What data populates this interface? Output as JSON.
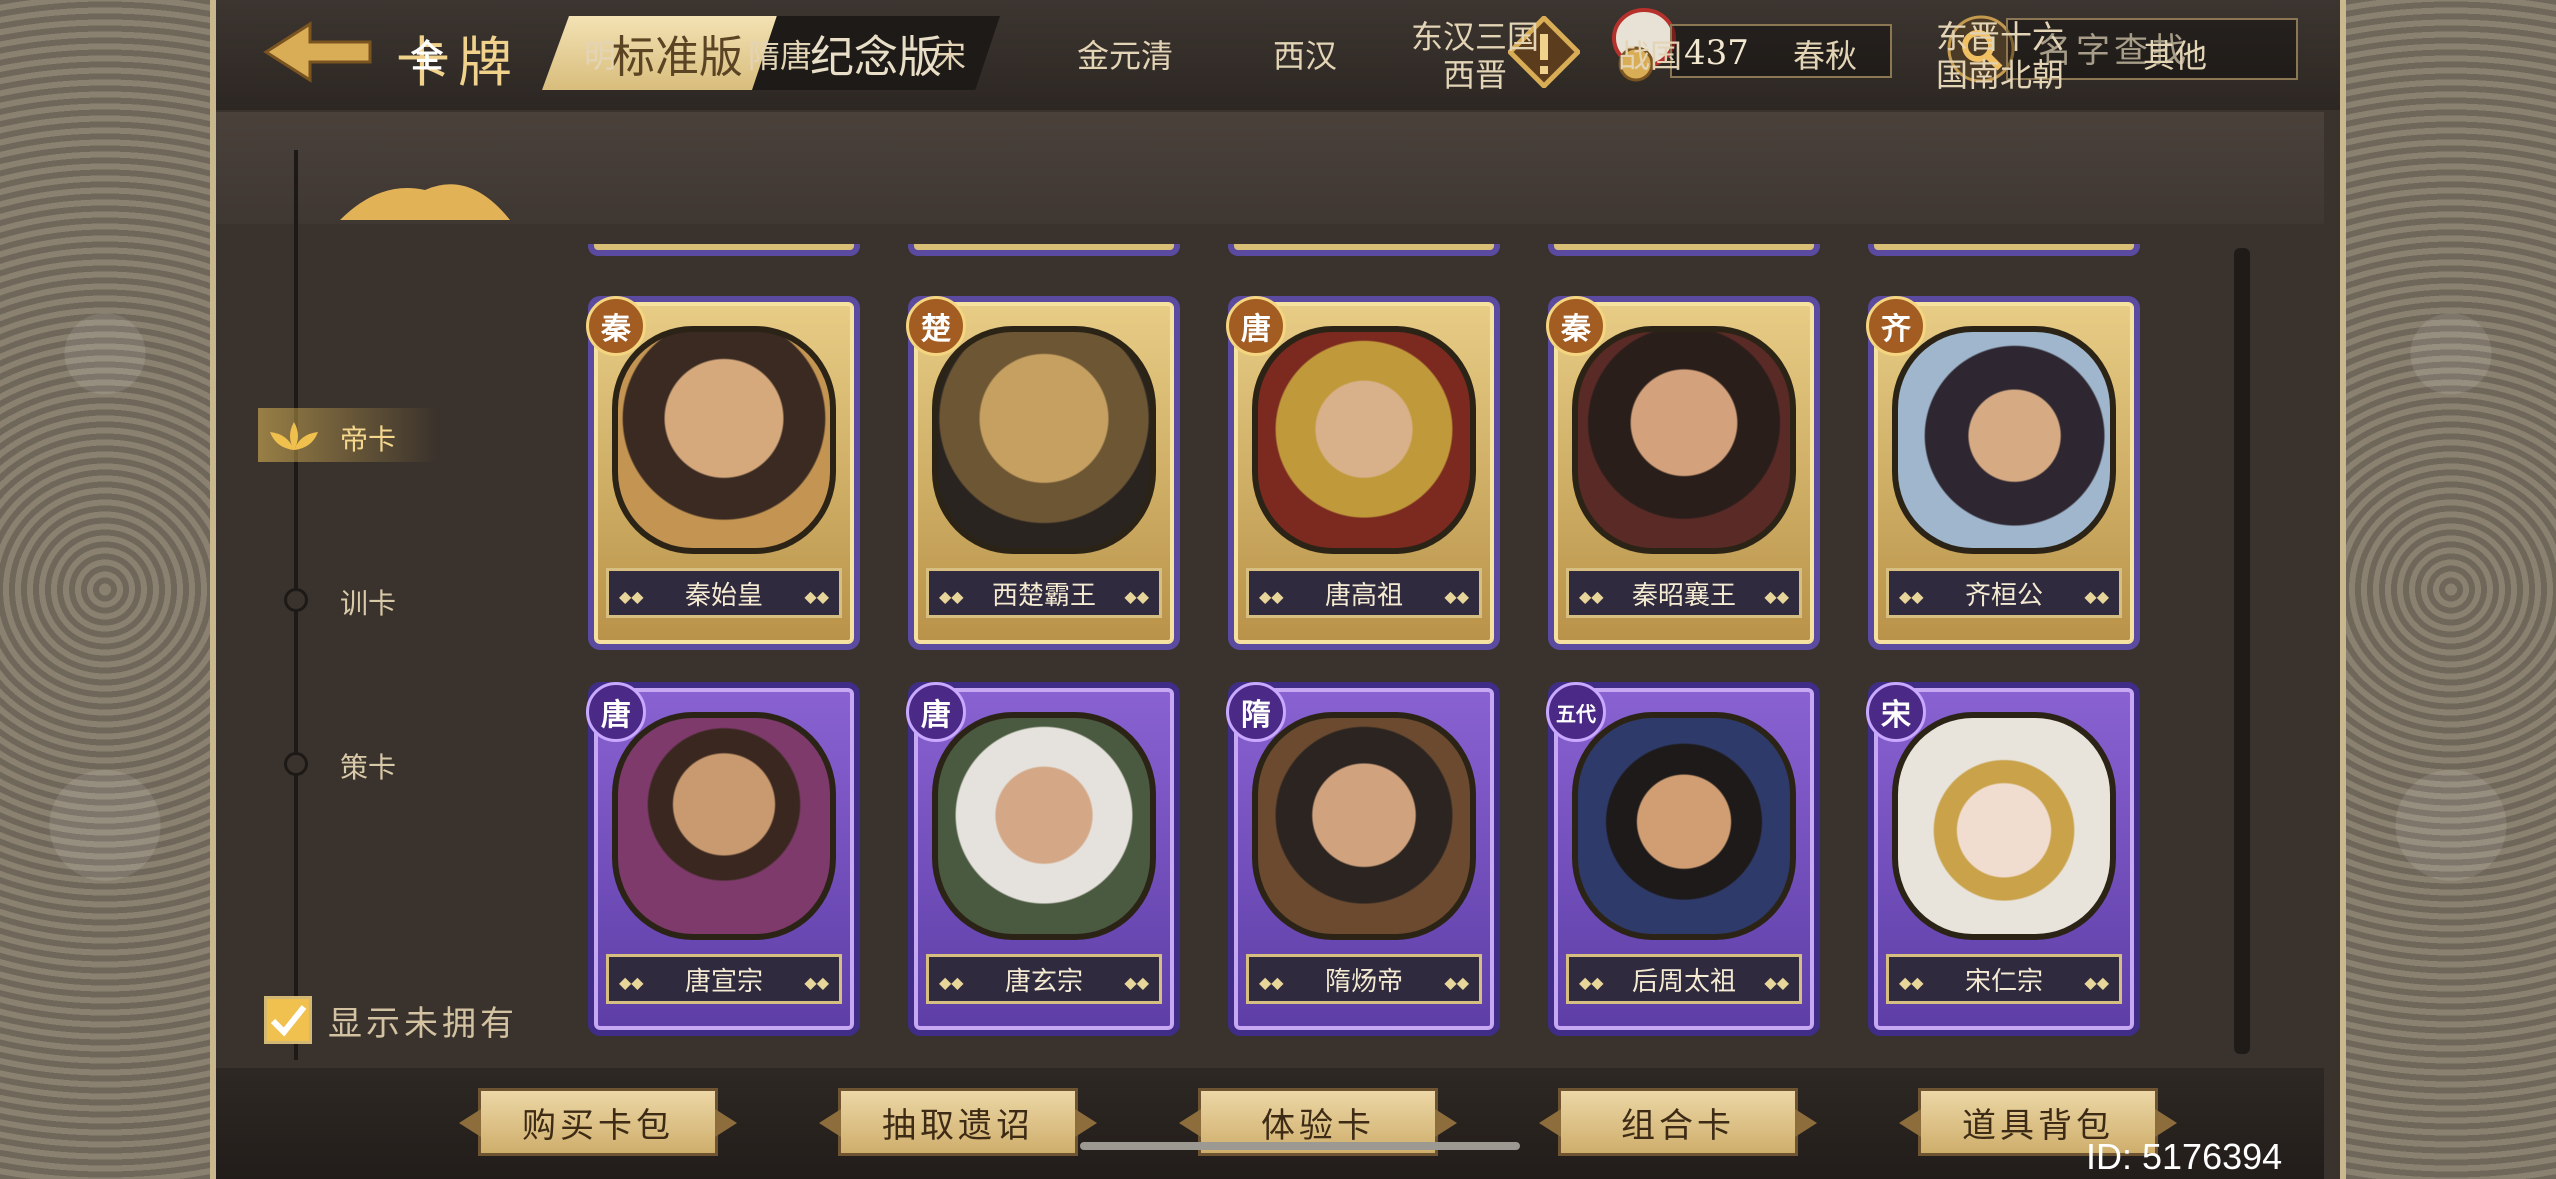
{
  "header": {
    "title": "卡牌",
    "tabs": [
      {
        "label": "标准版",
        "active": true
      },
      {
        "label": "纪念版",
        "active": false
      }
    ],
    "currency_value": "437",
    "search_placeholder": "名字查找"
  },
  "categories": [
    {
      "label": "全",
      "active": true
    },
    {
      "label": "明"
    },
    {
      "label": "隋唐"
    },
    {
      "label": "宋"
    },
    {
      "label": "金元清"
    },
    {
      "label": "西汉"
    },
    {
      "label": "东汉三国\n西晋"
    },
    {
      "label": "战国"
    },
    {
      "label": "春秋"
    },
    {
      "label": "东晋十六\n国南北朝"
    },
    {
      "label": "其他"
    }
  ],
  "rail": {
    "items": [
      {
        "label": "帝卡",
        "active": true
      },
      {
        "label": "训卡"
      },
      {
        "label": "策卡"
      }
    ]
  },
  "cards": {
    "row1": [
      {
        "badge": "秦",
        "name": "秦始皇",
        "rarity": "gold"
      },
      {
        "badge": "楚",
        "name": "西楚霸王",
        "rarity": "gold"
      },
      {
        "badge": "唐",
        "name": "唐高祖",
        "rarity": "gold"
      },
      {
        "badge": "秦",
        "name": "秦昭襄王",
        "rarity": "gold"
      },
      {
        "badge": "齐",
        "name": "齐桓公",
        "rarity": "gold"
      }
    ],
    "row2": [
      {
        "badge": "唐",
        "name": "唐宣宗",
        "rarity": "purple"
      },
      {
        "badge": "唐",
        "name": "唐玄宗",
        "rarity": "purple"
      },
      {
        "badge": "隋",
        "name": "隋炀帝",
        "rarity": "purple"
      },
      {
        "badge": "五代",
        "name": "后周太祖",
        "rarity": "purple"
      },
      {
        "badge": "宋",
        "name": "宋仁宗",
        "rarity": "purple"
      }
    ]
  },
  "show_unowned": {
    "label": "显示未拥有",
    "checked": true
  },
  "bottom_buttons": [
    "购买卡包",
    "抽取遗诏",
    "体验卡",
    "组合卡",
    "道具背包"
  ],
  "uid": "ID: 5176394",
  "colors": {
    "gold_accent": "#f1d28c",
    "purple_card": "#6a48b6",
    "gold_card": "#d6b468"
  }
}
